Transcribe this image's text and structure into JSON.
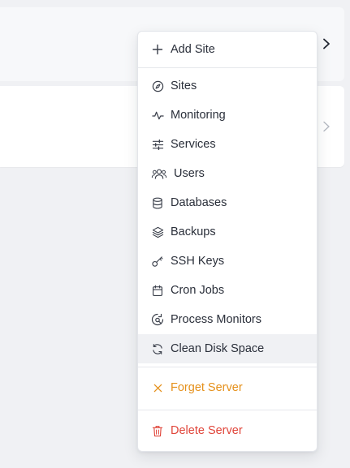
{
  "menu": {
    "add_site": {
      "label": "Add Site",
      "icon": "plus-icon"
    },
    "items": [
      {
        "label": "Sites",
        "icon": "compass-icon"
      },
      {
        "label": "Monitoring",
        "icon": "activity-icon"
      },
      {
        "label": "Services",
        "icon": "sliders-icon"
      },
      {
        "label": "Users",
        "icon": "users-icon"
      },
      {
        "label": "Databases",
        "icon": "database-icon"
      },
      {
        "label": "Backups",
        "icon": "layers-icon"
      },
      {
        "label": "SSH Keys",
        "icon": "key-icon"
      },
      {
        "label": "Cron Jobs",
        "icon": "calendar-icon"
      },
      {
        "label": "Process Monitors",
        "icon": "process-icon"
      },
      {
        "label": "Clean Disk Space",
        "icon": "refresh-icon"
      }
    ],
    "forget_server": {
      "label": "Forget Server",
      "icon": "close-icon"
    },
    "delete_server": {
      "label": "Delete Server",
      "icon": "trash-icon"
    }
  },
  "colors": {
    "text": "#2a2f3a",
    "warning": "#e5901a",
    "danger": "#e0453a",
    "active_bg": "#f0f1f4"
  }
}
